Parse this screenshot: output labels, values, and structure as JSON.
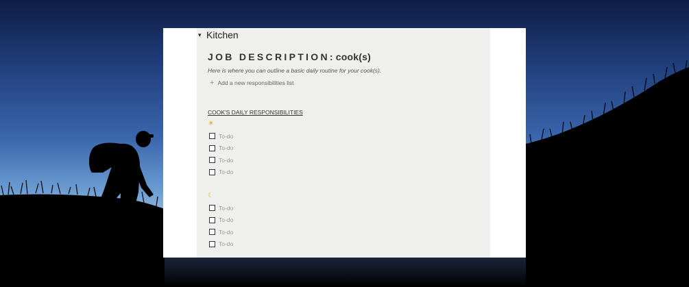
{
  "colors": {
    "sky_top": "#0d1d46",
    "sky_horizon": "#8fb6df",
    "silhouette": "#000000",
    "panel_bg": "#efefed",
    "accent_text": "#333333"
  },
  "wallpaper": {
    "description_icon": "hiker-silhouette-icon"
  },
  "page": {
    "toggle_icon": "▾",
    "toggle_title": "Kitchen",
    "title_main": "JOB DESCRIPTION",
    "title_suffix": ": cook(s)",
    "intro": "Here is where you can outline a basic daily routine for your cook(s).",
    "add_list_icon": "+",
    "add_list_label": "Add a new responsibilities list",
    "section_title": "COOK'S DAILY RESPONSIBILITIES",
    "morning_icon": "☀",
    "evening_icon": "☾",
    "morning_todos": [
      "To-do",
      "To-do",
      "To-do",
      "To-do"
    ],
    "evening_todos": [
      "To-do",
      "To-do",
      "To-do",
      "To-do"
    ]
  }
}
